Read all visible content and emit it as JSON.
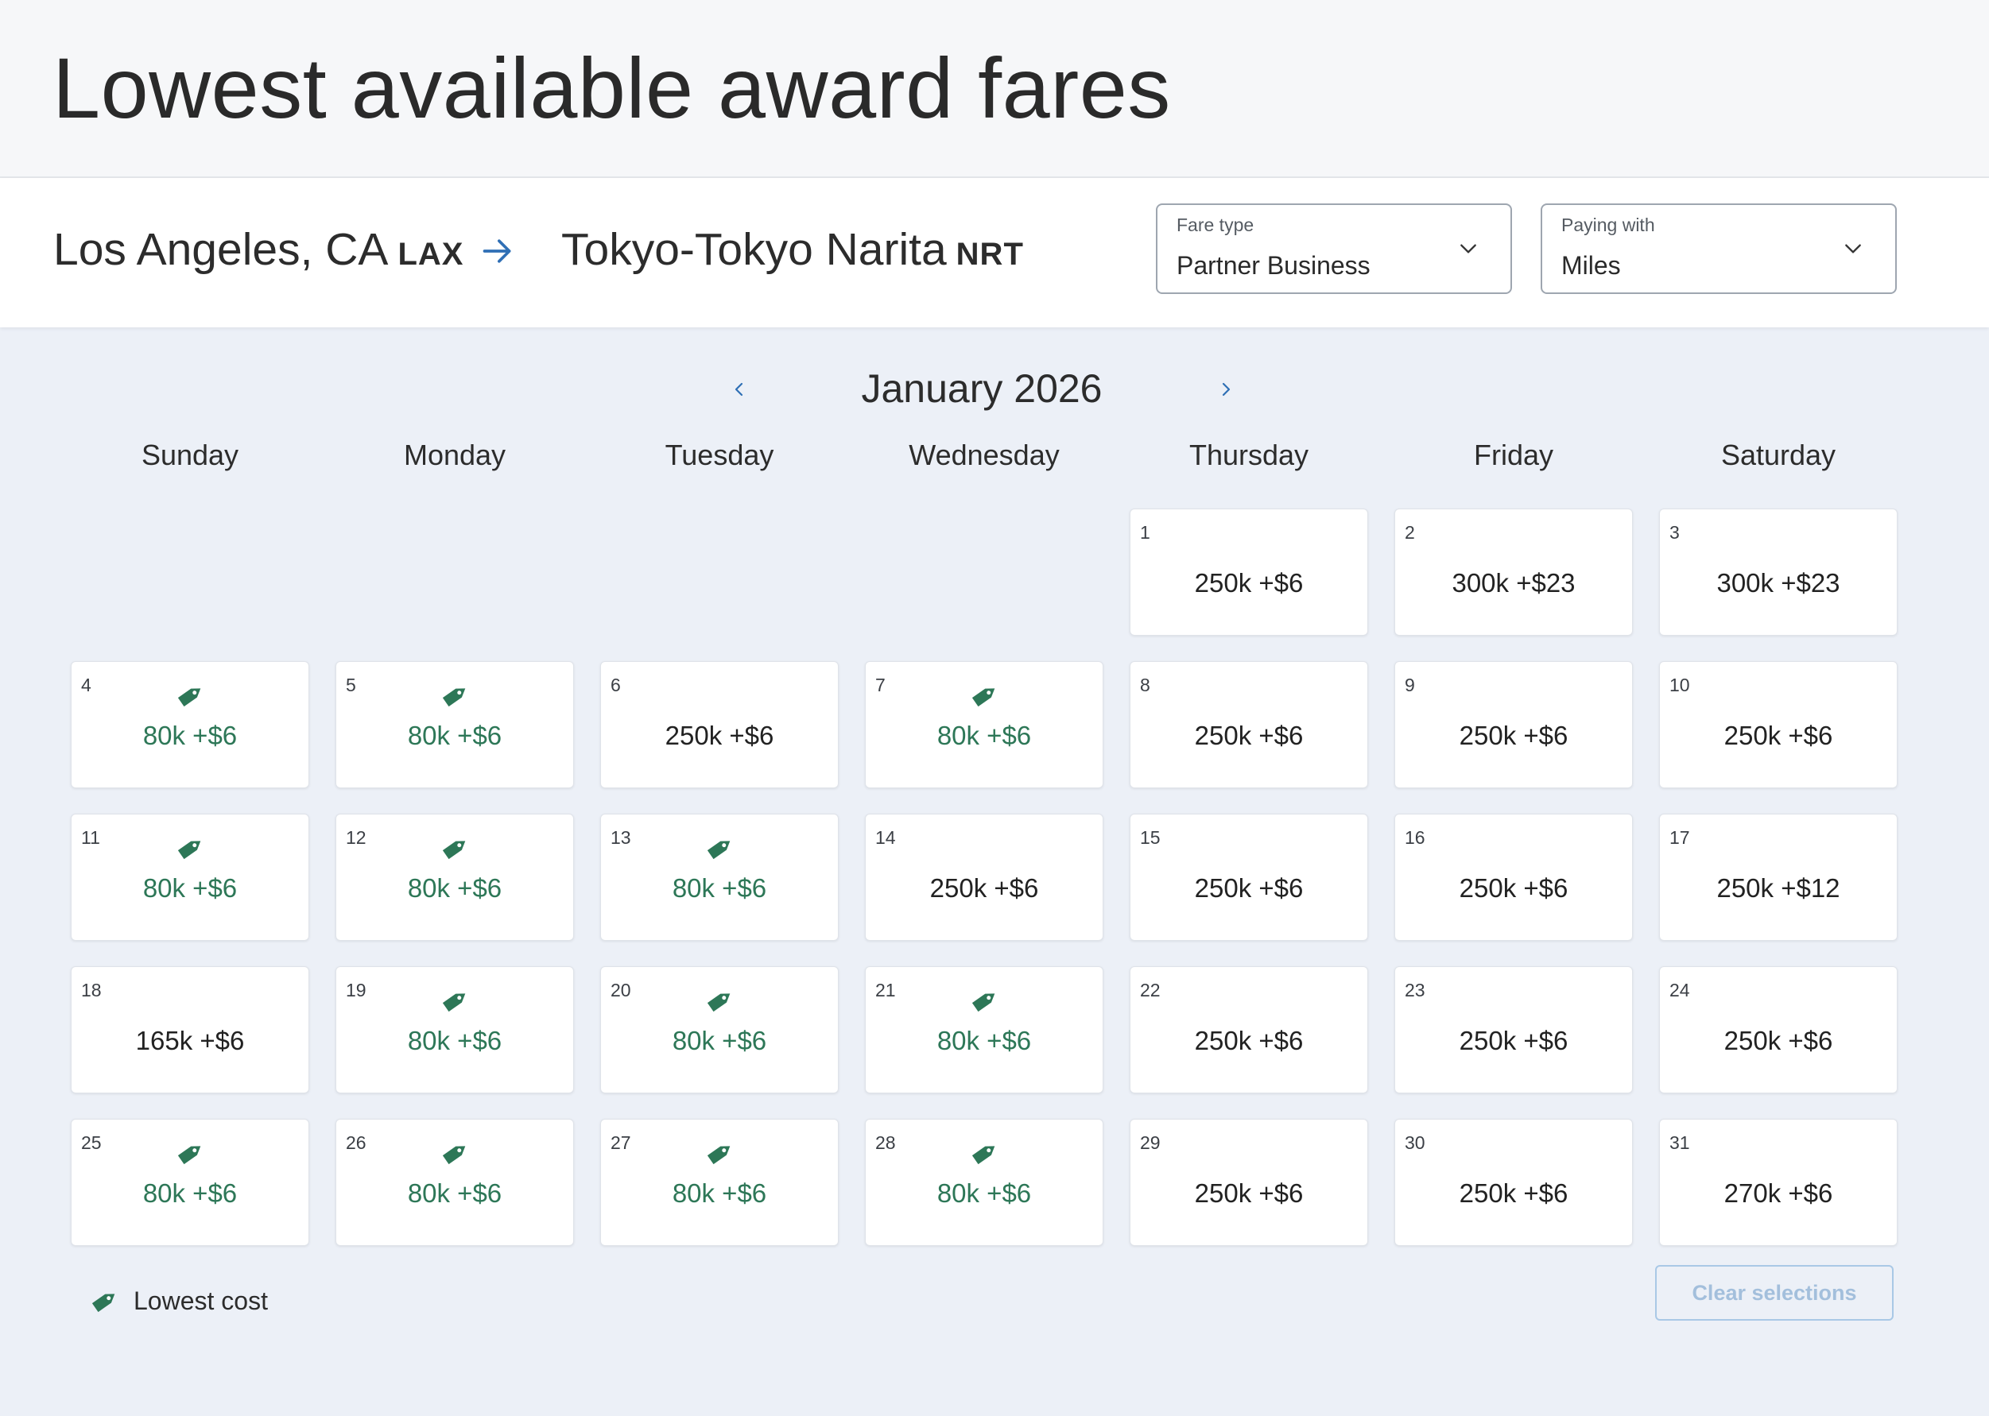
{
  "page": {
    "title": "Lowest available award fares"
  },
  "route": {
    "origin_city": "Los Angeles, CA",
    "origin_code": "LAX",
    "destination_city": "Tokyo-Tokyo Narita",
    "destination_code": "NRT",
    "arrow_icon": "arrow-right-icon"
  },
  "fare_type": {
    "label": "Fare type",
    "value": "Partner Business"
  },
  "paying_with": {
    "label": "Paying with",
    "value": "Miles"
  },
  "month": {
    "title": "January 2026",
    "prev_icon": "chevron-left-icon",
    "next_icon": "chevron-right-icon"
  },
  "weekdays": [
    "Sunday",
    "Monday",
    "Tuesday",
    "Wednesday",
    "Thursday",
    "Friday",
    "Saturday"
  ],
  "first_weekday_index": 4,
  "days": [
    {
      "day": "1",
      "price": "250k +$6",
      "lowest": false
    },
    {
      "day": "2",
      "price": "300k +$23",
      "lowest": false
    },
    {
      "day": "3",
      "price": "300k +$23",
      "lowest": false
    },
    {
      "day": "4",
      "price": "80k +$6",
      "lowest": true
    },
    {
      "day": "5",
      "price": "80k +$6",
      "lowest": true
    },
    {
      "day": "6",
      "price": "250k +$6",
      "lowest": false
    },
    {
      "day": "7",
      "price": "80k +$6",
      "lowest": true
    },
    {
      "day": "8",
      "price": "250k +$6",
      "lowest": false
    },
    {
      "day": "9",
      "price": "250k +$6",
      "lowest": false
    },
    {
      "day": "10",
      "price": "250k +$6",
      "lowest": false
    },
    {
      "day": "11",
      "price": "80k +$6",
      "lowest": true
    },
    {
      "day": "12",
      "price": "80k +$6",
      "lowest": true
    },
    {
      "day": "13",
      "price": "80k +$6",
      "lowest": true
    },
    {
      "day": "14",
      "price": "250k +$6",
      "lowest": false
    },
    {
      "day": "15",
      "price": "250k +$6",
      "lowest": false
    },
    {
      "day": "16",
      "price": "250k +$6",
      "lowest": false
    },
    {
      "day": "17",
      "price": "250k +$12",
      "lowest": false
    },
    {
      "day": "18",
      "price": "165k +$6",
      "lowest": false
    },
    {
      "day": "19",
      "price": "80k +$6",
      "lowest": true
    },
    {
      "day": "20",
      "price": "80k +$6",
      "lowest": true
    },
    {
      "day": "21",
      "price": "80k +$6",
      "lowest": true
    },
    {
      "day": "22",
      "price": "250k +$6",
      "lowest": false
    },
    {
      "day": "23",
      "price": "250k +$6",
      "lowest": false
    },
    {
      "day": "24",
      "price": "250k +$6",
      "lowest": false
    },
    {
      "day": "25",
      "price": "80k +$6",
      "lowest": true
    },
    {
      "day": "26",
      "price": "80k +$6",
      "lowest": true
    },
    {
      "day": "27",
      "price": "80k +$6",
      "lowest": true
    },
    {
      "day": "28",
      "price": "80k +$6",
      "lowest": true
    },
    {
      "day": "29",
      "price": "250k +$6",
      "lowest": false
    },
    {
      "day": "30",
      "price": "250k +$6",
      "lowest": false
    },
    {
      "day": "31",
      "price": "270k +$6",
      "lowest": false
    }
  ],
  "legend": {
    "icon": "price-tag-icon",
    "label": "Lowest cost"
  },
  "actions": {
    "clear_label": "Clear selections"
  },
  "colors": {
    "lowest_price": "#2d7757",
    "accent_blue": "#2f6fb5",
    "page_bg": "#ecf0f7"
  }
}
